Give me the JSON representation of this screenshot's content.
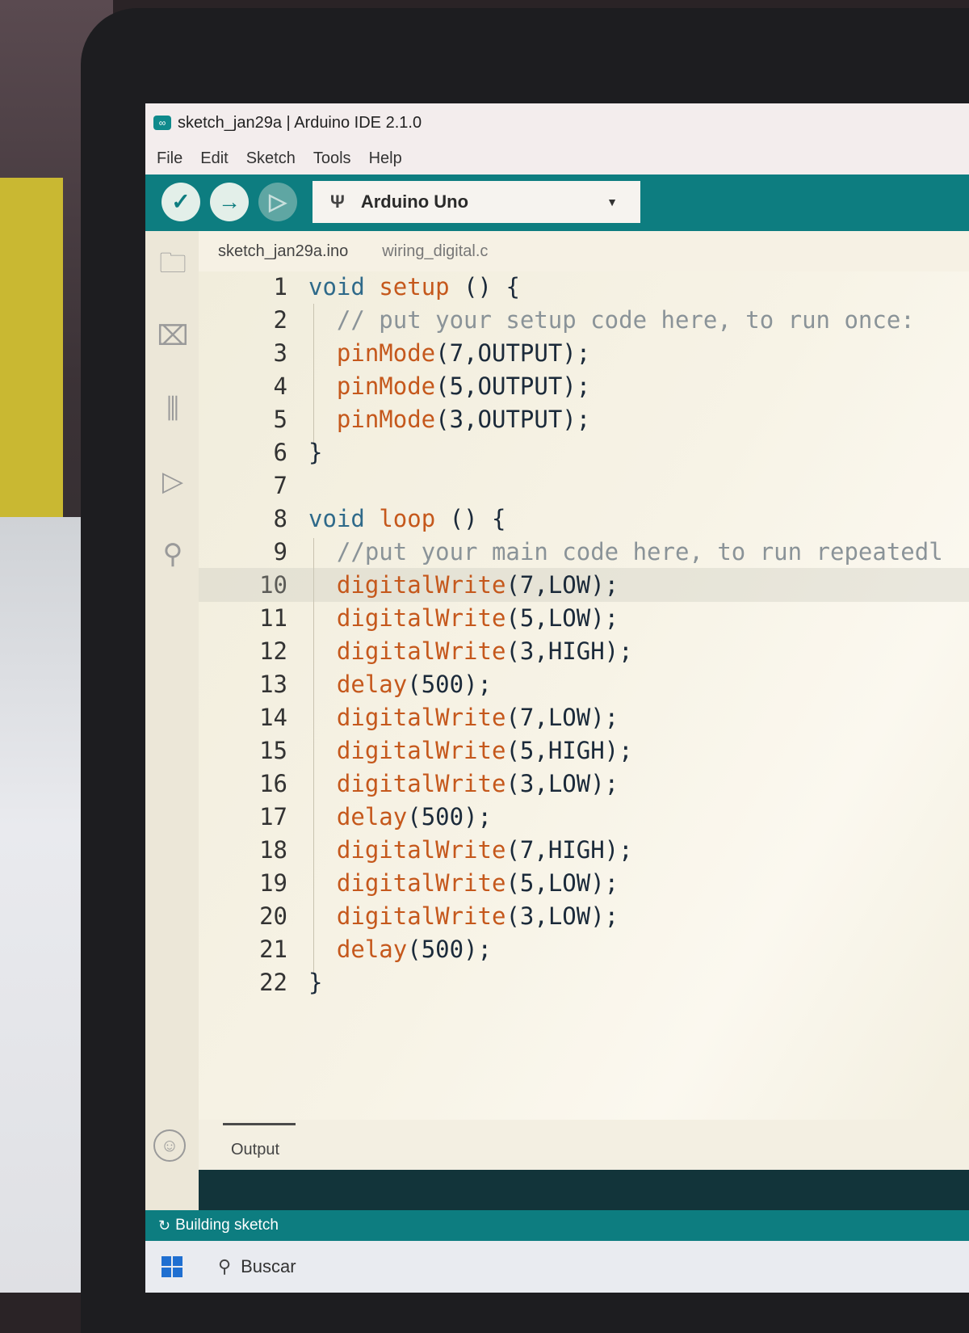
{
  "window": {
    "title": "sketch_jan29a | Arduino IDE 2.1.0",
    "app_icon": "arduino-logo-icon"
  },
  "menu": [
    "File",
    "Edit",
    "Sketch",
    "Tools",
    "Help"
  ],
  "toolbar": {
    "verify_icon": "checkmark-icon",
    "upload_icon": "arrow-right-icon",
    "debug_icon": "debugger-icon",
    "board": "Arduino Uno",
    "board_icon": "usb-icon"
  },
  "sidebar": [
    "folder-icon",
    "board-manager-icon",
    "library-icon",
    "debug-icon",
    "search-icon",
    "account-icon"
  ],
  "tabs": [
    "sketch_jan29a.ino",
    "wiring_digital.c"
  ],
  "code_lines": [
    "void setup () {",
    "  // put your setup code here, to run once:",
    "  pinMode(7,OUTPUT);",
    "  pinMode(5,OUTPUT);",
    "  pinMode(3,OUTPUT);",
    "}",
    "",
    "void loop () {",
    "  //put your main code here, to run repeatedl",
    "  digitalWrite(7,LOW);",
    "  digitalWrite(5,LOW);",
    "  digitalWrite(3,HIGH);",
    "  delay(500);",
    "  digitalWrite(7,LOW);",
    "  digitalWrite(5,HIGH);",
    "  digitalWrite(3,LOW);",
    "  delay(500);",
    "  digitalWrite(7,HIGH);",
    "  digitalWrite(5,LOW);",
    "  digitalWrite(3,LOW);",
    "  delay(500);",
    "}"
  ],
  "active_line": 10,
  "output": {
    "label": "Output"
  },
  "status": {
    "text": "Building sketch"
  },
  "taskbar": {
    "search_placeholder": "Buscar"
  },
  "colors": {
    "accent": "#0d7d80",
    "keyword": "#2f6a8a",
    "function": "#c5581c",
    "comment": "#8a9398"
  }
}
